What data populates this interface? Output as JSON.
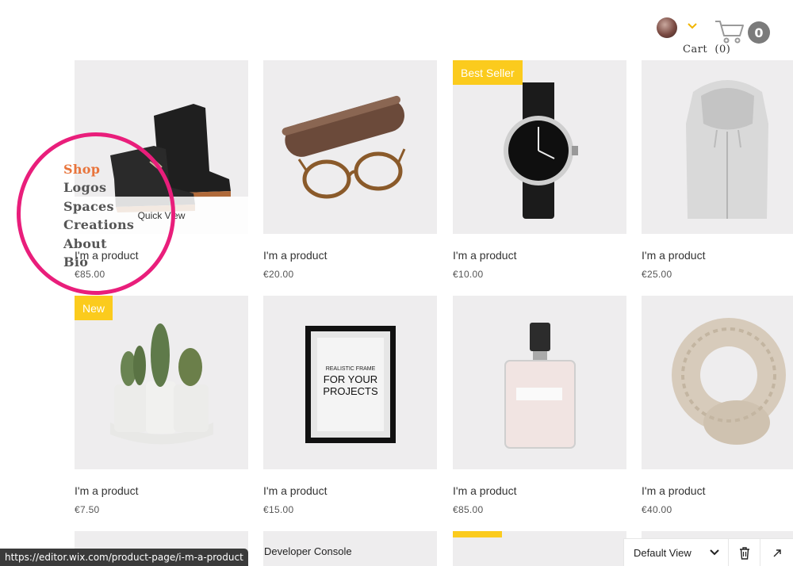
{
  "header": {
    "avatar": "user-avatar",
    "dropdown_icon": "chevron-down-icon",
    "cart_icon": "cart-icon",
    "cart_count": "0",
    "cart_label": "Cart  (0)"
  },
  "nav": {
    "items": [
      "Shop",
      "Logos",
      "Spaces",
      "Creations",
      "About",
      "Bio"
    ],
    "active": "Shop"
  },
  "products": [
    {
      "name": "I'm a product",
      "price": "€85.00",
      "image": "boots",
      "ribbon": "",
      "quick_view": "Quick View"
    },
    {
      "name": "I'm a product",
      "price": "€20.00",
      "image": "glasses-and-case",
      "ribbon": "",
      "quick_view": ""
    },
    {
      "name": "I'm a product",
      "price": "€10.00",
      "image": "watch",
      "ribbon": "Best Seller",
      "quick_view": ""
    },
    {
      "name": "I'm a product",
      "price": "€25.00",
      "image": "hoodie",
      "ribbon": "",
      "quick_view": ""
    },
    {
      "name": "I'm a product",
      "price": "€7.50",
      "image": "cactus-planter",
      "ribbon": "New",
      "quick_view": ""
    },
    {
      "name": "I'm a product",
      "price": "€15.00",
      "image": "picture-frame",
      "ribbon": "",
      "quick_view": "",
      "frame_text": [
        "REALISTIC FRAME",
        "FOR YOUR",
        "PROJECTS"
      ]
    },
    {
      "name": "I'm a product",
      "price": "€85.00",
      "image": "perfume-bottle",
      "ribbon": "",
      "quick_view": ""
    },
    {
      "name": "I'm a product",
      "price": "€40.00",
      "image": "knit-scarf",
      "ribbon": "",
      "quick_view": ""
    }
  ],
  "bottom": {
    "status_url": "https://editor.wix.com/product-page/i-m-a-product",
    "developer_console": "Developer Console",
    "view_select": "Default View",
    "trash_icon": "trash-icon",
    "expand_icon": "expand-arrow-icon"
  },
  "colors": {
    "ribbon": "#fbcb1d",
    "nav_active": "#e8743b",
    "highlight_circle": "#e91e7b",
    "card_bg": "#eeedee"
  }
}
